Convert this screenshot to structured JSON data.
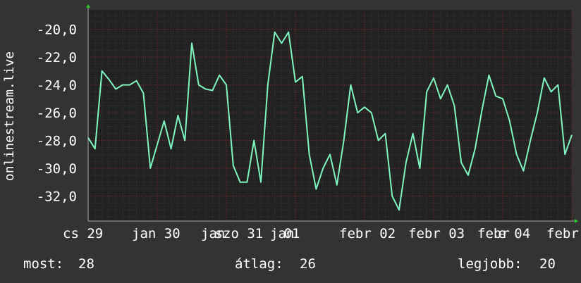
{
  "chart_data": {
    "type": "line",
    "ylabel": "onlinestream.live",
    "ylim": [
      -33.8,
      -18.6
    ],
    "yticks": [
      -20,
      -22,
      -24,
      -26,
      -28,
      -30,
      -32
    ],
    "ytick_labels": [
      "-20,0",
      "-22,0",
      "-24,0",
      "-26,0",
      "-28,0",
      "-30,0",
      "-32,0"
    ],
    "xlim": [
      0,
      7.0
    ],
    "xticks": [
      {
        "x": 0.0,
        "label": "cs 29"
      },
      {
        "x": 1.0,
        "label": "jan 30"
      },
      {
        "x": 2.0,
        "label": "jan"
      },
      {
        "x": 2.2,
        "label": "szo 31"
      },
      {
        "x": 3.0,
        "label": "jan"
      },
      {
        "x": 3.2,
        "label": "01"
      },
      {
        "x": 4.0,
        "label": "febr 02"
      },
      {
        "x": 5.0,
        "label": "febr 03"
      },
      {
        "x": 6.0,
        "label": "febr"
      },
      {
        "x": 6.3,
        "label": "e 04"
      },
      {
        "x": 7.0,
        "label": "febr"
      }
    ],
    "grid": true,
    "series": [
      {
        "color": "#7ff5bf",
        "x": [
          0,
          0.1,
          0.2,
          0.3,
          0.4,
          0.5,
          0.6,
          0.7,
          0.8,
          0.9,
          1.0,
          1.1,
          1.2,
          1.3,
          1.4,
          1.5,
          1.6,
          1.7,
          1.8,
          1.9,
          2.0,
          2.1,
          2.2,
          2.3,
          2.4,
          2.5,
          2.6,
          2.7,
          2.8,
          2.9,
          3.0,
          3.1,
          3.2,
          3.3,
          3.4,
          3.5,
          3.6,
          3.7,
          3.8,
          3.9,
          4.0,
          4.1,
          4.2,
          4.3,
          4.4,
          4.5,
          4.6,
          4.7,
          4.8,
          4.9,
          5.0,
          5.1,
          5.2,
          5.3,
          5.4,
          5.5,
          5.6,
          5.7,
          5.8,
          5.9,
          6.0,
          6.1,
          6.2,
          6.3,
          6.4,
          6.5,
          6.6,
          6.7,
          6.8,
          6.9,
          7.0
        ],
        "values": [
          -27.8,
          -28.6,
          -23.0,
          -23.6,
          -24.3,
          -24.0,
          -24.0,
          -23.7,
          -24.6,
          -30.0,
          -28.3,
          -26.6,
          -28.6,
          -26.2,
          -28.0,
          -21.0,
          -24.0,
          -24.3,
          -24.4,
          -23.3,
          -24.0,
          -29.8,
          -31.0,
          -31.0,
          -28.0,
          -31.0,
          -24.0,
          -20.2,
          -21.0,
          -20.2,
          -23.8,
          -23.4,
          -29.0,
          -31.5,
          -30.0,
          -29.0,
          -31.2,
          -28.0,
          -24.0,
          -26.0,
          -25.6,
          -26.0,
          -28.0,
          -27.5,
          -32.0,
          -33.0,
          -29.6,
          -27.5,
          -30.0,
          -24.5,
          -23.5,
          -25.0,
          -24.0,
          -25.5,
          -29.6,
          -30.5,
          -28.6,
          -25.8,
          -23.3,
          -24.8,
          -25.0,
          -26.6,
          -29.0,
          -30.2,
          -28.0,
          -26.0,
          -23.5,
          -24.5,
          -24.0,
          -29.0,
          -27.6
        ]
      }
    ]
  },
  "legend": {
    "current_label": "most:",
    "current_value": "28",
    "average_label": "átlag:",
    "average_value": "26",
    "best_label": "legjobb:",
    "best_value": "20"
  }
}
